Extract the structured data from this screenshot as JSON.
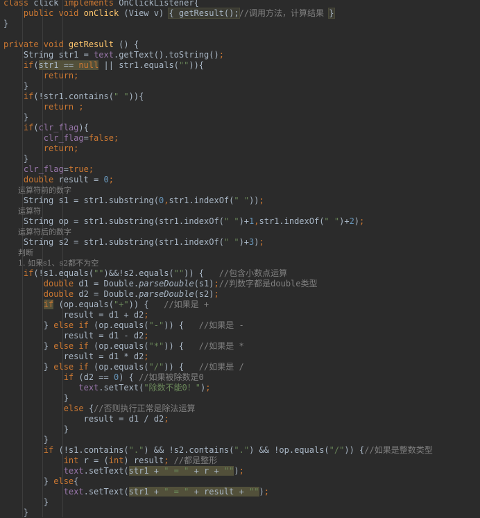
{
  "editor": {
    "lines": [
      {
        "indent": "",
        "segs": [
          [
            "kw",
            "class "
          ],
          [
            "",
            "click "
          ],
          [
            "kw",
            "implements "
          ],
          [
            "",
            "OnClickListener{"
          ]
        ]
      },
      {
        "indent": "    ",
        "segs": [
          [
            "kw",
            "public void "
          ],
          [
            "fn",
            "onClick "
          ],
          [
            "",
            "(View v) "
          ],
          [
            "hl",
            "{ getResult();"
          ],
          [
            "cm",
            "//调用方法，计算结果 "
          ],
          [
            "hl",
            "}"
          ]
        ]
      },
      {
        "indent": "",
        "segs": [
          [
            "",
            "}"
          ]
        ]
      },
      {
        "indent": "",
        "segs": []
      },
      {
        "indent": "",
        "segs": [
          [
            "kw",
            "private void "
          ],
          [
            "fn",
            "getResult "
          ],
          [
            "",
            "() {"
          ]
        ]
      },
      {
        "indent": "    ",
        "segs": [
          [
            "",
            "String str1 = "
          ],
          [
            "fld",
            "text"
          ],
          [
            "",
            ".getText().toString()"
          ],
          [
            "kw",
            ";"
          ]
        ]
      },
      {
        "indent": "    ",
        "segs": [
          [
            "kw",
            "if"
          ],
          [
            "",
            "("
          ],
          [
            "hlw",
            "str1 == "
          ],
          [
            "hlkw",
            "null"
          ],
          [
            "",
            " || str1.equals("
          ],
          [
            "str",
            "\"\""
          ],
          [
            "",
            "))"
          ],
          [
            "",
            "{"
          ]
        ]
      },
      {
        "indent": "        ",
        "segs": [
          [
            "kw",
            "return;"
          ]
        ]
      },
      {
        "indent": "    ",
        "segs": [
          [
            "",
            "}"
          ]
        ]
      },
      {
        "indent": "    ",
        "segs": [
          [
            "kw",
            "if"
          ],
          [
            "",
            "(!str1.contains("
          ],
          [
            "str",
            "\" \""
          ],
          [
            "",
            "))"
          ],
          [
            "",
            "{"
          ]
        ]
      },
      {
        "indent": "        ",
        "segs": [
          [
            "kw",
            "return ;"
          ]
        ]
      },
      {
        "indent": "    ",
        "segs": [
          [
            "",
            "}"
          ]
        ]
      },
      {
        "indent": "    ",
        "segs": [
          [
            "kw",
            "if"
          ],
          [
            "",
            "("
          ],
          [
            "fld",
            "clr_flag"
          ],
          [
            "",
            "){"
          ]
        ]
      },
      {
        "indent": "        ",
        "segs": [
          [
            "fld",
            "clr_flag"
          ],
          [
            "",
            "="
          ],
          [
            "kw",
            "false;"
          ]
        ]
      },
      {
        "indent": "        ",
        "segs": [
          [
            "kw",
            "return;"
          ]
        ]
      },
      {
        "indent": "    ",
        "segs": [
          [
            "",
            "}"
          ]
        ]
      },
      {
        "indent": "    ",
        "segs": [
          [
            "fld",
            "clr_flag"
          ],
          [
            "",
            "="
          ],
          [
            "kw",
            "true;"
          ]
        ]
      },
      {
        "indent": "    ",
        "segs": [
          [
            "kw",
            "double "
          ],
          [
            "",
            "result = "
          ],
          [
            "num",
            "0"
          ],
          [
            "kw",
            ";"
          ]
        ]
      },
      {
        "indent": "      ",
        "cmline": true,
        "segs": [
          [
            "cm",
            "运算符前的数字"
          ]
        ]
      },
      {
        "indent": "    ",
        "segs": [
          [
            "",
            "String s1 = str1.substring("
          ],
          [
            "num",
            "0"
          ],
          [
            "kw",
            ","
          ],
          [
            "",
            "str1.indexOf("
          ],
          [
            "str",
            "\" \""
          ],
          [
            "",
            "))"
          ],
          [
            "kw",
            ";"
          ]
        ]
      },
      {
        "indent": "      ",
        "cmline": true,
        "segs": [
          [
            "cm",
            "运算符"
          ]
        ]
      },
      {
        "indent": "    ",
        "segs": [
          [
            "",
            "String op = str1.substring(str1.indexOf("
          ],
          [
            "str",
            "\" \""
          ],
          [
            "",
            ")+"
          ],
          [
            "num",
            "1"
          ],
          [
            "kw",
            ","
          ],
          [
            "",
            "str1.indexOf("
          ],
          [
            "str",
            "\" \""
          ],
          [
            "",
            ")+"
          ],
          [
            "num",
            "2"
          ],
          [
            "",
            ")"
          ],
          [
            "kw",
            ";"
          ]
        ]
      },
      {
        "indent": "      ",
        "cmline": true,
        "segs": [
          [
            "cm",
            "运算符后的数字"
          ]
        ]
      },
      {
        "indent": "    ",
        "segs": [
          [
            "",
            "String s2 = str1.substring(str1.indexOf("
          ],
          [
            "str",
            "\" \""
          ],
          [
            "",
            ")+"
          ],
          [
            "num",
            "3"
          ],
          [
            "",
            ")"
          ],
          [
            "kw",
            ";"
          ]
        ]
      },
      {
        "indent": "      ",
        "cmline": true,
        "segs": [
          [
            "cm",
            "判断"
          ]
        ]
      },
      {
        "indent": "      ",
        "cmline": true,
        "segs": [
          [
            "cm",
            "1. 如果s1、s2都不为空"
          ]
        ]
      },
      {
        "indent": "    ",
        "segs": [
          [
            "kw",
            "if"
          ],
          [
            "",
            "(!s1.equals("
          ],
          [
            "str",
            "\"\""
          ],
          [
            "",
            ")&&!s2.equals("
          ],
          [
            "str",
            "\"\""
          ],
          [
            "",
            ")) {   "
          ],
          [
            "cm",
            "//包含小数点运算"
          ]
        ]
      },
      {
        "indent": "        ",
        "segs": [
          [
            "kw",
            "double "
          ],
          [
            "",
            "d1 = Double."
          ],
          [
            "it",
            "parseDouble"
          ],
          [
            "",
            "(s1)"
          ],
          [
            "kw",
            ";"
          ],
          [
            "cm",
            "//判数字都是double类型"
          ]
        ]
      },
      {
        "indent": "        ",
        "segs": [
          [
            "kw",
            "double "
          ],
          [
            "",
            "d2 = Double."
          ],
          [
            "it",
            "parseDouble"
          ],
          [
            "",
            "(s2)"
          ],
          [
            "kw",
            ";"
          ]
        ]
      },
      {
        "indent": "        ",
        "segs": [
          [
            "hlkw",
            "if"
          ],
          [
            "",
            " (op.equals("
          ],
          [
            "str",
            "\"+\""
          ],
          [
            "",
            ")) {   "
          ],
          [
            "cm",
            "//如果是 +"
          ]
        ]
      },
      {
        "indent": "            ",
        "segs": [
          [
            "",
            "result = d1 + d2"
          ],
          [
            "kw",
            ";"
          ]
        ]
      },
      {
        "indent": "        ",
        "segs": [
          [
            "",
            "} "
          ],
          [
            "kw",
            "else if "
          ],
          [
            "",
            "(op.equals("
          ],
          [
            "str",
            "\"-\""
          ],
          [
            "",
            ")) {   "
          ],
          [
            "cm",
            "//如果是 -"
          ]
        ]
      },
      {
        "indent": "            ",
        "segs": [
          [
            "",
            "result = d1 - d2"
          ],
          [
            "kw",
            ";"
          ]
        ]
      },
      {
        "indent": "        ",
        "segs": [
          [
            "",
            "} "
          ],
          [
            "kw",
            "else if "
          ],
          [
            "",
            "(op.equals("
          ],
          [
            "str",
            "\"*\""
          ],
          [
            "",
            ")) {   "
          ],
          [
            "cm",
            "//如果是 *"
          ]
        ]
      },
      {
        "indent": "            ",
        "segs": [
          [
            "",
            "result = d1 * d2"
          ],
          [
            "kw",
            ";"
          ]
        ]
      },
      {
        "indent": "        ",
        "segs": [
          [
            "",
            "} "
          ],
          [
            "kw",
            "else if "
          ],
          [
            "",
            "(op.equals("
          ],
          [
            "str",
            "\"/\""
          ],
          [
            "",
            ")) {   "
          ],
          [
            "cm",
            "//如果是 /"
          ]
        ]
      },
      {
        "indent": "            ",
        "segs": [
          [
            "kw",
            "if "
          ],
          [
            "",
            "(d2 == "
          ],
          [
            "num",
            "0"
          ],
          [
            "",
            ") { "
          ],
          [
            "cm",
            "//如果被除数是0"
          ]
        ]
      },
      {
        "indent": "               ",
        "segs": [
          [
            "fld",
            "text"
          ],
          [
            "",
            ".setText("
          ],
          [
            "str",
            "\"除数不能0！\""
          ],
          [
            "",
            ")"
          ],
          [
            "kw",
            ";"
          ]
        ]
      },
      {
        "indent": "            ",
        "segs": [
          [
            "",
            "}"
          ]
        ]
      },
      {
        "indent": "            ",
        "segs": [
          [
            "kw",
            "else "
          ],
          [
            "",
            "{"
          ],
          [
            "cm",
            "//否则执行正常是除法运算"
          ]
        ]
      },
      {
        "indent": "                ",
        "segs": [
          [
            "",
            "result = d1 / d2"
          ],
          [
            "kw",
            ";"
          ]
        ]
      },
      {
        "indent": "            ",
        "segs": [
          [
            "",
            "}"
          ]
        ]
      },
      {
        "indent": "        ",
        "segs": [
          [
            "",
            "}"
          ]
        ]
      },
      {
        "indent": "        ",
        "segs": [
          [
            "kw",
            "if "
          ],
          [
            "",
            "(!s1.contains("
          ],
          [
            "str",
            "\".\""
          ],
          [
            "",
            ") && !s2.contains("
          ],
          [
            "str",
            "\".\""
          ],
          [
            "",
            ") && !op.equals("
          ],
          [
            "str",
            "\"/\""
          ],
          [
            "",
            ")) {"
          ],
          [
            "cm",
            "//如果是整数类型"
          ]
        ]
      },
      {
        "indent": "            ",
        "segs": [
          [
            "kw",
            "int "
          ],
          [
            "",
            "r = ("
          ],
          [
            "kw",
            "int"
          ],
          [
            "",
            ") result"
          ],
          [
            "kw",
            "; "
          ],
          [
            "cm",
            "//都是整形"
          ]
        ]
      },
      {
        "indent": "            ",
        "segs": [
          [
            "fld",
            "text"
          ],
          [
            "",
            ".setText("
          ],
          [
            "hlw",
            "str1 + "
          ],
          [
            "hlstr",
            "\" = \""
          ],
          [
            "hlw",
            " + r + "
          ],
          [
            "hlstr",
            "\"\""
          ],
          [
            "",
            ")"
          ],
          [
            "kw",
            ";"
          ]
        ]
      },
      {
        "indent": "        ",
        "segs": [
          [
            "",
            "} "
          ],
          [
            "kw",
            "else"
          ],
          [
            "",
            "{"
          ]
        ]
      },
      {
        "indent": "            ",
        "segs": [
          [
            "fld",
            "text"
          ],
          [
            "",
            ".setText("
          ],
          [
            "hlw",
            "str1 + "
          ],
          [
            "hlstr",
            "\" = \""
          ],
          [
            "hlw",
            " + result + "
          ],
          [
            "hlstr",
            "\"\""
          ],
          [
            "",
            ")"
          ],
          [
            "kw",
            ";"
          ]
        ]
      },
      {
        "indent": "        ",
        "segs": [
          [
            "",
            "}"
          ]
        ]
      },
      {
        "indent": "    ",
        "segs": [
          [
            "",
            "}"
          ]
        ]
      }
    ]
  }
}
